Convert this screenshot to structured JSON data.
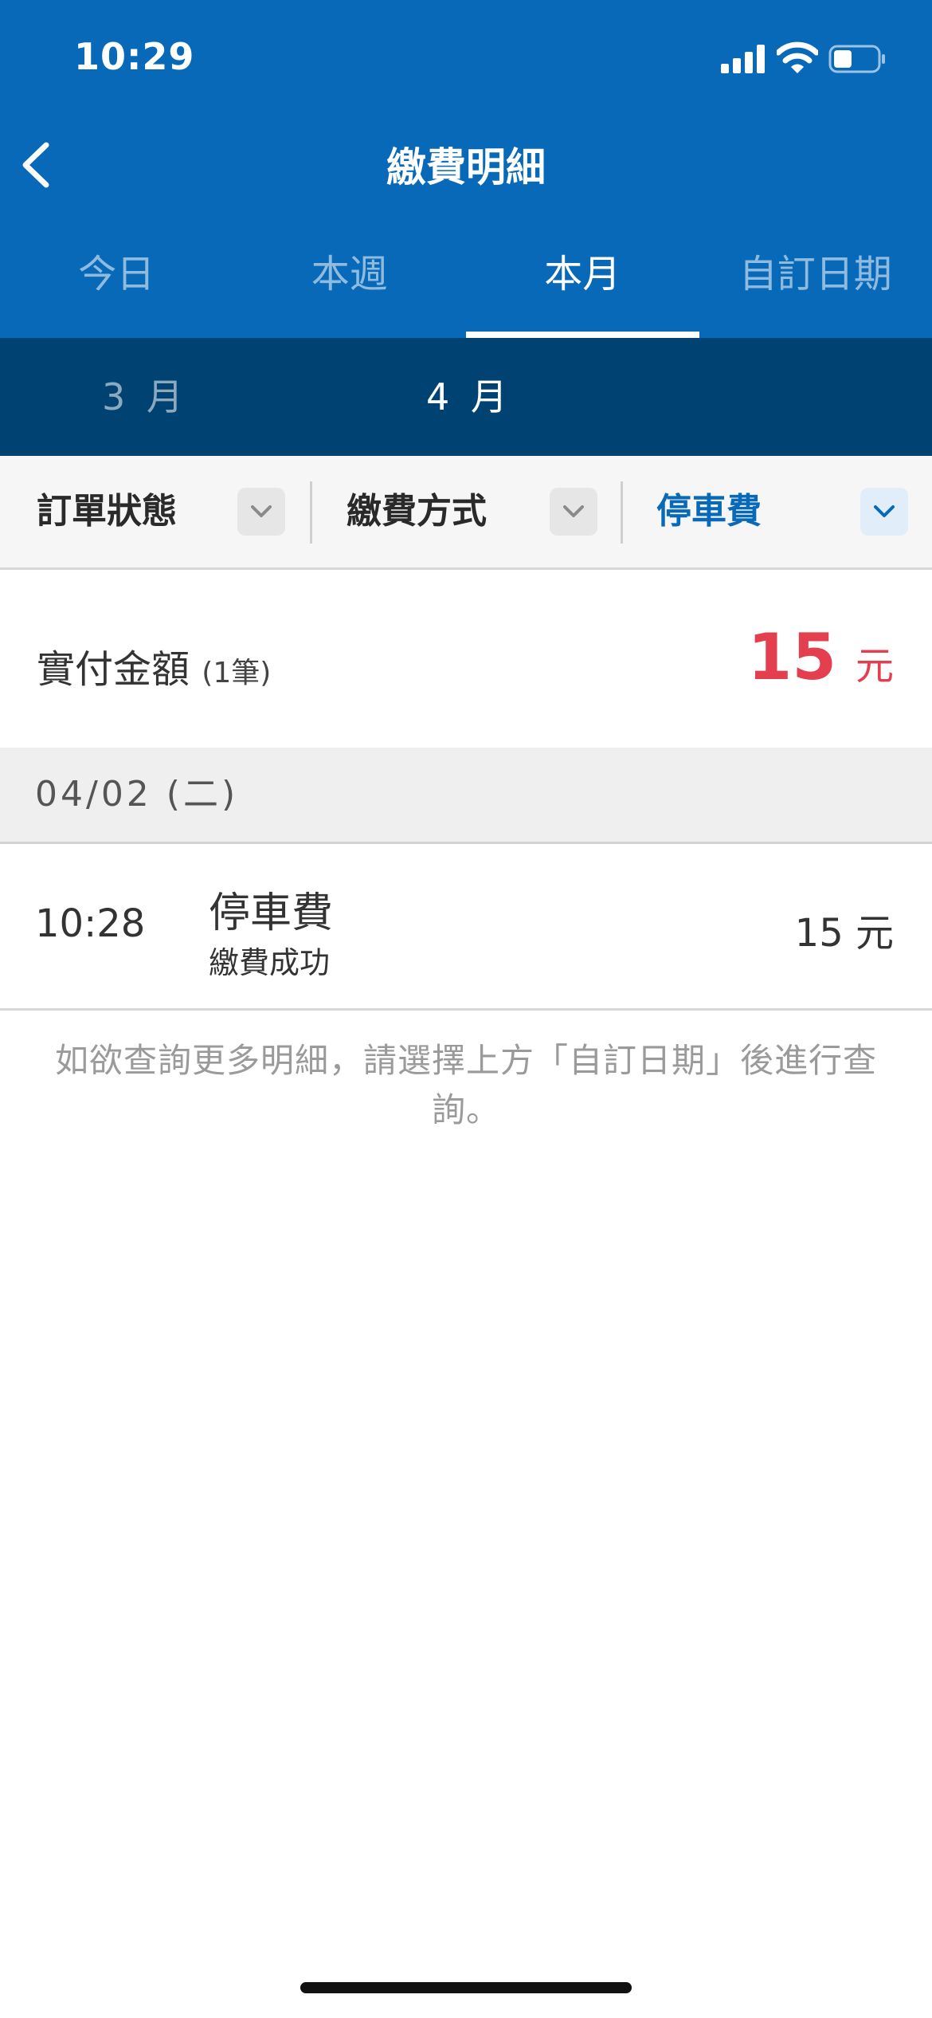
{
  "status_bar": {
    "time": "10:29"
  },
  "nav": {
    "title": "繳費明細"
  },
  "tabs": [
    {
      "label": "今日",
      "active": false
    },
    {
      "label": "本週",
      "active": false
    },
    {
      "label": "本月",
      "active": true
    },
    {
      "label": "自訂日期",
      "active": false
    }
  ],
  "months": [
    {
      "label": "3 月",
      "selected": false
    },
    {
      "label": "4 月",
      "selected": true
    }
  ],
  "filters": {
    "order_status": "訂單狀態",
    "payment_method": "繳費方式",
    "category": "停車費"
  },
  "summary": {
    "label": "實付金額",
    "count": "(1筆)",
    "amount": "15",
    "unit": "元"
  },
  "records": [
    {
      "date": "04/02 (二)",
      "time": "10:28",
      "name": "停車費",
      "status": "繳費成功",
      "amount": "15 元"
    }
  ],
  "note": "如欲查詢更多明細，請選擇上方「自訂日期」後進行查詢。",
  "colors": {
    "header": "#0769b8",
    "month_bar": "#004372",
    "accent_blue": "#0769b8",
    "amount_red": "#e43f4f"
  }
}
